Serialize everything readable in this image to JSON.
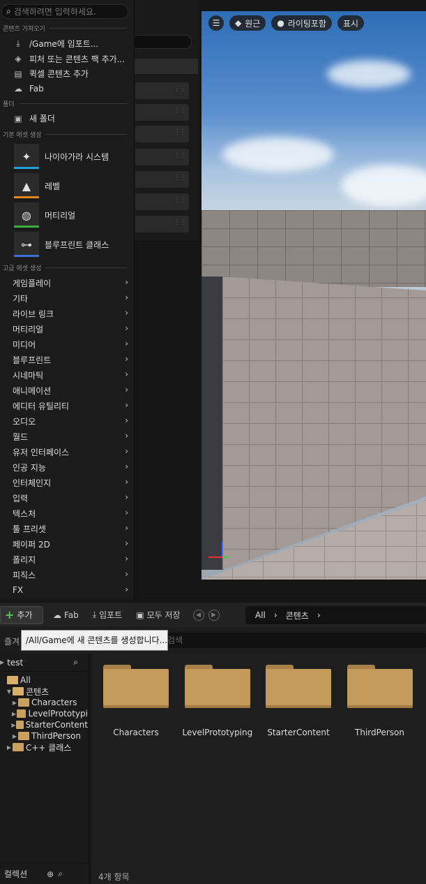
{
  "menu": {
    "search_placeholder": "검색하려면 입력하세요.",
    "section_import": "콘텐츠 가져오기",
    "import_items": [
      {
        "label": "/Game에 임포트...",
        "icon": "import-icon"
      },
      {
        "label": "피처 또는 콘텐츠 팩 추가...",
        "icon": "feature-pack-icon"
      },
      {
        "label": "퀵셀 콘텐츠 추가",
        "icon": "quixel-icon"
      },
      {
        "label": "Fab",
        "icon": "fab-icon"
      }
    ],
    "section_folder": "폴더",
    "new_folder": "새 폴더",
    "section_basic": "기본 에셋 생성",
    "basic_assets": [
      {
        "label": "나이아가라 시스템",
        "color": "#1da1d6",
        "icon": "niagara-icon"
      },
      {
        "label": "레벨",
        "color": "#e2861c",
        "icon": "level-icon"
      },
      {
        "label": "머티리얼",
        "color": "#3cad3c",
        "icon": "material-icon"
      },
      {
        "label": "블루프린트 클래스",
        "color": "#3c6ed8",
        "icon": "blueprint-icon"
      }
    ],
    "section_advanced": "고급 에셋 생성",
    "advanced": [
      "게임플레이",
      "기타",
      "라이브 링크",
      "머티리얼",
      "미디어",
      "블루프린트",
      "시네마틱",
      "애니메이션",
      "에디터 유틸리티",
      "오디오",
      "월드",
      "유저 인터페이스",
      "인공 지능",
      "인터체인지",
      "입력",
      "텍스처",
      "툴 프리셋",
      "페이퍼 2D",
      "폴리지",
      "피직스",
      "FX"
    ]
  },
  "viewport": {
    "perspective": "원근",
    "lighting": "라이팅포함",
    "show": "표시"
  },
  "toolbar": {
    "add": "추가",
    "fab": "Fab",
    "import": "임포트",
    "save_all": "모두 저장",
    "path_all": "All",
    "path_content": "콘텐츠"
  },
  "tooltip": "/All/Game에 새 콘텐츠를 생성합니다...",
  "favorites_label": "즐겨",
  "content_search_placeholder": "검색",
  "tree": {
    "search": "test",
    "items": [
      {
        "label": "All",
        "indent": 0,
        "open": true,
        "arrow": ""
      },
      {
        "label": "콘텐츠",
        "indent": 1,
        "open": true,
        "arrow": "▼"
      },
      {
        "label": "Characters",
        "indent": 2,
        "open": false,
        "arrow": "▶"
      },
      {
        "label": "LevelPrototypi",
        "indent": 2,
        "open": false,
        "arrow": "▶"
      },
      {
        "label": "StarterContent",
        "indent": 2,
        "open": false,
        "arrow": "▶"
      },
      {
        "label": "ThirdPerson",
        "indent": 2,
        "open": false,
        "arrow": "▶"
      },
      {
        "label": "C++ 클래스",
        "indent": 1,
        "open": false,
        "arrow": "▶"
      }
    ],
    "collections": "컬렉션"
  },
  "assets": [
    "Characters",
    "LevelPrototyping",
    "StarterContent",
    "ThirdPerson"
  ],
  "item_count": "4개 항목"
}
